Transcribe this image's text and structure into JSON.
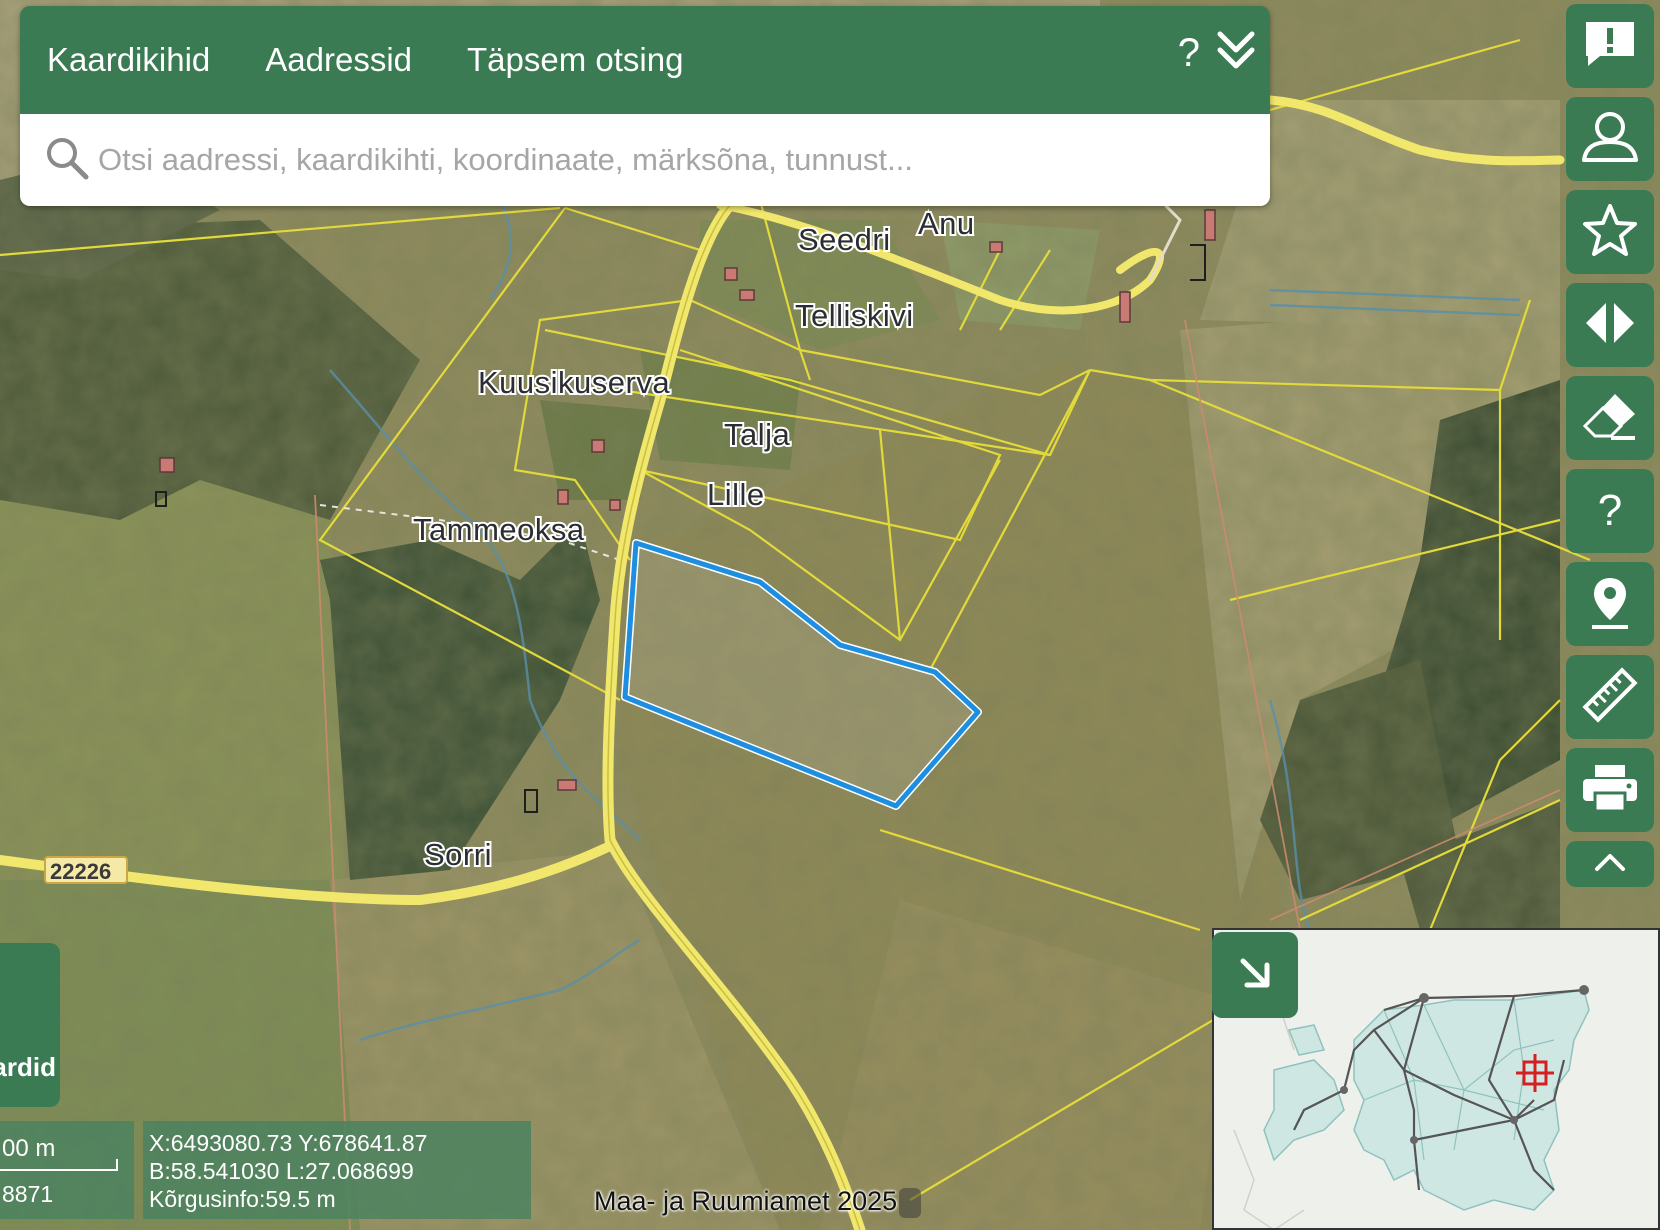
{
  "search_panel": {
    "tabs": [
      "Kaardikihid",
      "Aadressid",
      "Täpsem otsing"
    ],
    "help_label": "?",
    "collapse_icon": "double-chevron-down-icon",
    "search_icon": "search-icon",
    "search_placeholder": "Otsi aadressi, kaardikihti, koordinaate, märksõna, tunnust..."
  },
  "toolbar": {
    "buttons": [
      {
        "name": "feedback",
        "icon": "feedback-icon"
      },
      {
        "name": "user",
        "icon": "user-icon"
      },
      {
        "name": "favorites",
        "icon": "star-icon"
      },
      {
        "name": "compare",
        "icon": "swipe-compare-icon"
      },
      {
        "name": "clear",
        "icon": "eraser-icon"
      },
      {
        "name": "help",
        "icon": "help-icon",
        "label": "?"
      },
      {
        "name": "location",
        "icon": "location-pin-icon"
      },
      {
        "name": "measure",
        "icon": "ruler-icon"
      },
      {
        "name": "print",
        "icon": "printer-icon"
      },
      {
        "name": "collapse",
        "icon": "chevron-up-icon"
      }
    ]
  },
  "map": {
    "place_labels": [
      "Seedri",
      "Anu",
      "Telliskivi",
      "Kuusikuserva",
      "Talja",
      "Lille",
      "Tammeoksa",
      "Sorri"
    ],
    "road_number": "22226",
    "highlight_color": "#1e8fe0",
    "parcel_color": "#e2d93a",
    "road_color": "#efe26a"
  },
  "base_maps": {
    "label": "ardid"
  },
  "scale": {
    "distance": "00 m",
    "ratio": "8871"
  },
  "coordinates": {
    "xy": "X:6493080.73 Y:678641.87",
    "bl": "B:58.541030 L:27.068699",
    "height": "Kõrgusinfo:59.5 m"
  },
  "attribution": "Maa- ja Ruumiamet 2025",
  "overview": {
    "toggle_icon": "arrow-down-right-icon",
    "marker_color": "#d42020"
  }
}
